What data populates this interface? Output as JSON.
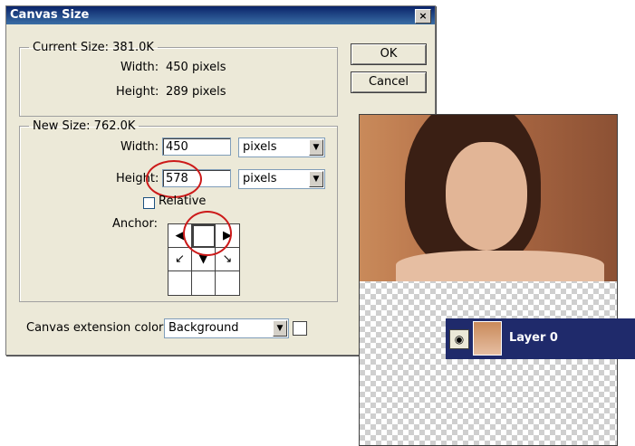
{
  "dialog": {
    "title": "Canvas Size",
    "close_label": "×",
    "ok_label": "OK",
    "cancel_label": "Cancel",
    "current": {
      "legend": "Current Size: 381.0K",
      "width_label": "Width:",
      "width_value": "450 pixels",
      "height_label": "Height:",
      "height_value": "289 pixels"
    },
    "new": {
      "legend": "New Size: 762.0K",
      "width_label": "Width:",
      "width_value": "450",
      "width_unit": "pixels",
      "height_label": "Height:",
      "height_value": "578",
      "height_unit": "pixels",
      "relative_label": "Relative",
      "relative_checked": false,
      "anchor_label": "Anchor:"
    },
    "extension": {
      "label": "Canvas extension color:",
      "value": "Background"
    }
  },
  "layers": {
    "layer_name": "Layer 0"
  },
  "colors": {
    "highlight_ring": "#cc1a1a",
    "layer_selected": "#1f2a6b",
    "title_bar": "#0a246a"
  }
}
